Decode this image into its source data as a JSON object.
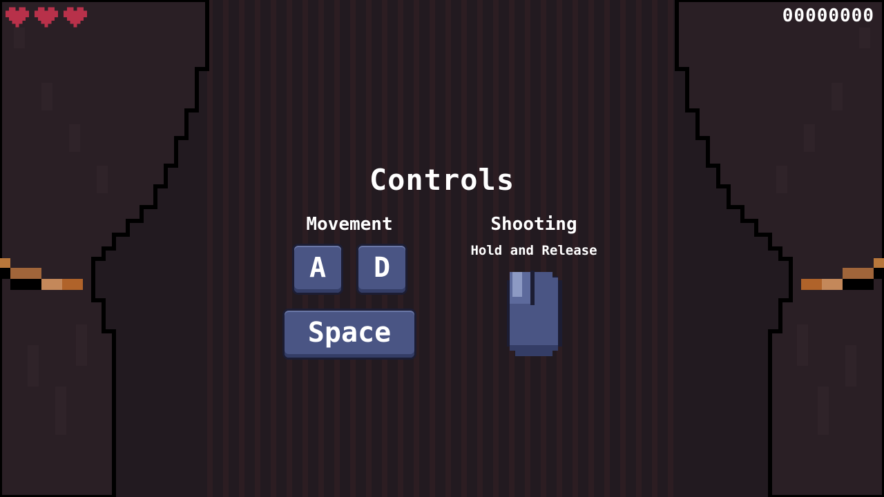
{
  "hud": {
    "hearts": 3,
    "heart_color": "#b8314a",
    "score": "00000000"
  },
  "controls": {
    "title": "Controls",
    "movement": {
      "heading": "Movement",
      "keys": [
        "A",
        "D"
      ],
      "jump_key": "Space"
    },
    "shooting": {
      "heading": "Shooting",
      "instruction": "Hold and Release",
      "icon": "mouse-icon"
    }
  },
  "colors": {
    "background": "#221a20",
    "curtain": "#2b2026",
    "curtain_outline": "#000000",
    "key_fill": "#4a5584",
    "tieback": "#b76a2e"
  }
}
